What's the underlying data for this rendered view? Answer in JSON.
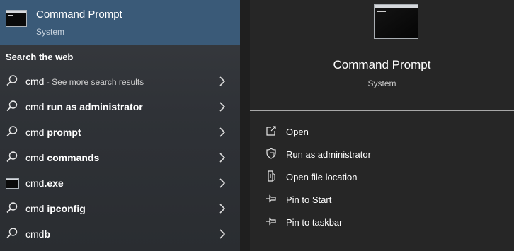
{
  "best_match": {
    "title": "Command Prompt",
    "subtitle": "System",
    "icon": "command-prompt-icon"
  },
  "search_web": {
    "heading": "Search the web",
    "items": [
      {
        "query": "cmd",
        "suffix": "",
        "extra": " - See more search results",
        "icon": "search-icon"
      },
      {
        "query": "cmd ",
        "suffix": "run as administrator",
        "extra": "",
        "icon": "search-icon"
      },
      {
        "query": "cmd ",
        "suffix": "prompt",
        "extra": "",
        "icon": "search-icon"
      },
      {
        "query": "cmd ",
        "suffix": "commands",
        "extra": "",
        "icon": "search-icon"
      },
      {
        "query": "cmd",
        "suffix": ".exe",
        "extra": "",
        "icon": "command-prompt-icon"
      },
      {
        "query": "cmd ",
        "suffix": "ipconfig",
        "extra": "",
        "icon": "search-icon"
      },
      {
        "query": "cmd",
        "suffix": "b",
        "extra": "",
        "icon": "search-icon"
      }
    ]
  },
  "preview": {
    "title": "Command Prompt",
    "subtitle": "System",
    "actions": [
      {
        "label": "Open",
        "icon": "open-icon"
      },
      {
        "label": "Run as administrator",
        "icon": "shield-icon"
      },
      {
        "label": "Open file location",
        "icon": "file-location-icon"
      },
      {
        "label": "Pin to Start",
        "icon": "pin-icon"
      },
      {
        "label": "Pin to taskbar",
        "icon": "pin-icon"
      }
    ]
  },
  "colors": {
    "best_match_bg": "#3a5a78",
    "left_bg": "#2f3237",
    "right_bg": "#262626"
  }
}
